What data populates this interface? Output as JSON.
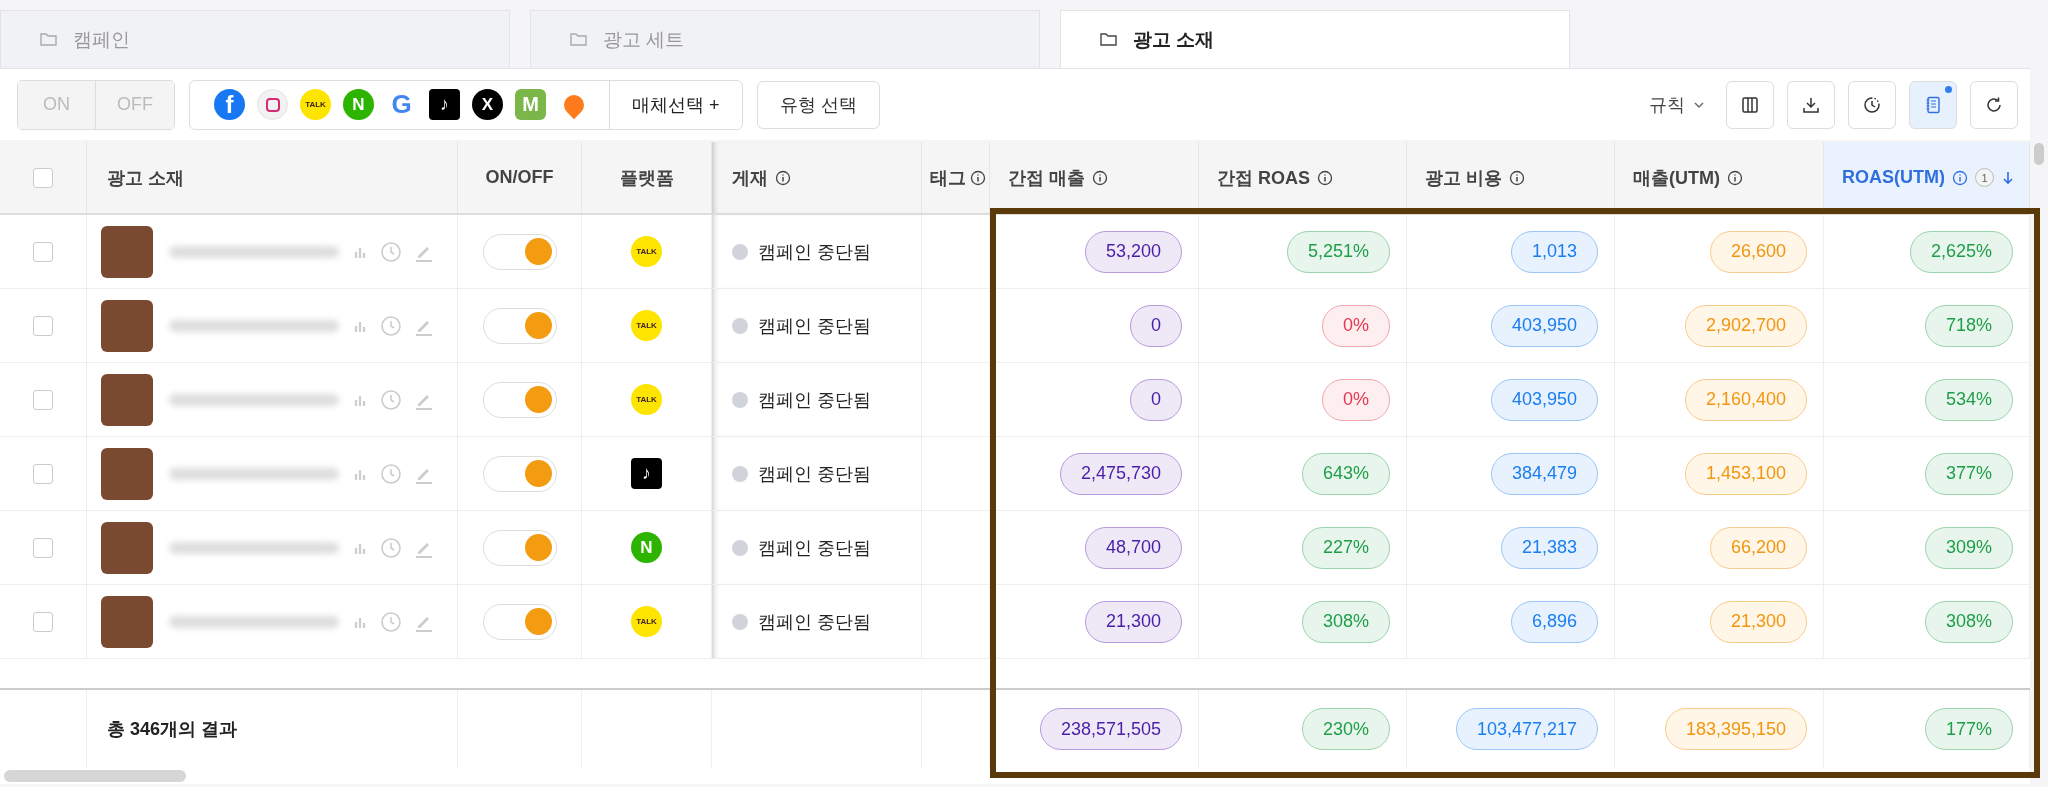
{
  "tabs": [
    {
      "label": "캠페인",
      "selected": false
    },
    {
      "label": "광고 세트",
      "selected": false
    },
    {
      "label": "광고 소재",
      "selected": true
    }
  ],
  "toolbar": {
    "onoff": [
      {
        "label": "ON",
        "disabled": true
      },
      {
        "label": "OFF",
        "disabled": true
      }
    ],
    "media": [
      {
        "kind": "facebook",
        "glyph": "f"
      },
      {
        "kind": "instagram"
      },
      {
        "kind": "kakao",
        "glyph": "TALK"
      },
      {
        "kind": "naver",
        "glyph": "N"
      },
      {
        "kind": "google",
        "glyph": "G"
      },
      {
        "kind": "tiktok",
        "glyph": "♪"
      },
      {
        "kind": "x",
        "glyph": "X"
      },
      {
        "kind": "m",
        "glyph": "M"
      },
      {
        "kind": "carrot"
      }
    ],
    "media_button": "매체선택 +",
    "type_button": "유형 선택",
    "rule": "규칙",
    "tools": [
      {
        "kind": "columns",
        "selected": false,
        "badge": false
      },
      {
        "kind": "download",
        "selected": false,
        "badge": false
      },
      {
        "kind": "history",
        "selected": false,
        "badge": false
      },
      {
        "kind": "notes",
        "selected": true,
        "badge": true
      },
      {
        "kind": "refresh",
        "selected": false,
        "badge": false
      }
    ]
  },
  "table": {
    "header_checked": false,
    "columns": [
      {
        "kind": "check"
      },
      {
        "kind": "name",
        "label": "광고 소재"
      },
      {
        "kind": "toggle",
        "label": "ON/OFF"
      },
      {
        "kind": "platform",
        "label": "플랫폼"
      },
      {
        "kind": "status",
        "label": "게재",
        "info": true
      },
      {
        "kind": "tag",
        "label": "태그",
        "info": true
      },
      {
        "kind": "indirect_revenue",
        "label": "간접 매출",
        "info": true,
        "sorted": false
      },
      {
        "kind": "indirect_roas",
        "label": "간접 ROAS",
        "info": true,
        "sorted": false
      },
      {
        "kind": "cost",
        "label": "광고 비용",
        "info": true,
        "sorted": false
      },
      {
        "kind": "utm_revenue",
        "label": "매출(UTM)",
        "info": true,
        "sorted": false
      },
      {
        "kind": "utm_roas",
        "label": "ROAS(UTM)",
        "info": true,
        "sorted": true,
        "sort_rank": "1"
      }
    ],
    "rows": [
      {
        "checked": false,
        "on": true,
        "platform": {
          "kind": "kakao",
          "glyph": "TALK"
        },
        "status": "캠페인 중단됨",
        "metrics": [
          {
            "text": "53,200",
            "zero": false
          },
          {
            "text": "5,251%",
            "zero": false
          },
          {
            "text": "1,013",
            "zero": false
          },
          {
            "text": "26,600",
            "zero": false
          },
          {
            "text": "2,625%",
            "zero": false
          }
        ]
      },
      {
        "checked": false,
        "on": true,
        "platform": {
          "kind": "kakao",
          "glyph": "TALK"
        },
        "status": "캠페인 중단됨",
        "metrics": [
          {
            "text": "0",
            "zero": false
          },
          {
            "text": "0%",
            "zero": true
          },
          {
            "text": "403,950",
            "zero": false
          },
          {
            "text": "2,902,700",
            "zero": false
          },
          {
            "text": "718%",
            "zero": false
          }
        ]
      },
      {
        "checked": false,
        "on": true,
        "platform": {
          "kind": "kakao",
          "glyph": "TALK"
        },
        "status": "캠페인 중단됨",
        "metrics": [
          {
            "text": "0",
            "zero": false
          },
          {
            "text": "0%",
            "zero": true
          },
          {
            "text": "403,950",
            "zero": false
          },
          {
            "text": "2,160,400",
            "zero": false
          },
          {
            "text": "534%",
            "zero": false
          }
        ]
      },
      {
        "checked": false,
        "on": true,
        "platform": {
          "kind": "tiktok",
          "glyph": "♪"
        },
        "status": "캠페인 중단됨",
        "metrics": [
          {
            "text": "2,475,730",
            "zero": false
          },
          {
            "text": "643%",
            "zero": false
          },
          {
            "text": "384,479",
            "zero": false
          },
          {
            "text": "1,453,100",
            "zero": false
          },
          {
            "text": "377%",
            "zero": false
          }
        ]
      },
      {
        "checked": false,
        "on": true,
        "platform": {
          "kind": "naver",
          "glyph": "N"
        },
        "status": "캠페인 중단됨",
        "metrics": [
          {
            "text": "48,700",
            "zero": false
          },
          {
            "text": "227%",
            "zero": false
          },
          {
            "text": "21,383",
            "zero": false
          },
          {
            "text": "66,200",
            "zero": false
          },
          {
            "text": "309%",
            "zero": false
          }
        ]
      },
      {
        "checked": false,
        "on": true,
        "platform": {
          "kind": "kakao",
          "glyph": "TALK"
        },
        "status": "캠페인 중단됨",
        "metrics": [
          {
            "text": "21,300",
            "zero": false
          },
          {
            "text": "308%",
            "zero": false
          },
          {
            "text": "6,896",
            "zero": false
          },
          {
            "text": "21,300",
            "zero": false
          },
          {
            "text": "308%",
            "zero": false
          }
        ]
      }
    ],
    "footer": {
      "total": "총 346개의 결과",
      "metrics": [
        {
          "text": "238,571,505",
          "zero": false
        },
        {
          "text": "230%",
          "zero": false
        },
        {
          "text": "103,477,217",
          "zero": false
        },
        {
          "text": "183,395,150",
          "zero": false
        },
        {
          "text": "177%",
          "zero": false
        }
      ]
    }
  }
}
